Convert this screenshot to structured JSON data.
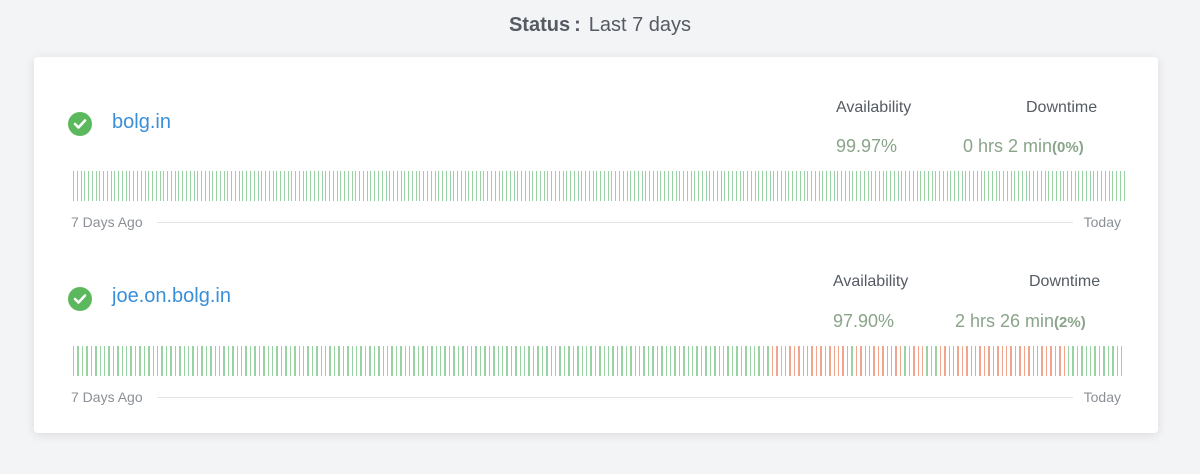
{
  "header": {
    "label": "Status",
    "colon": ":",
    "range": "Last 7 days"
  },
  "colors": {
    "up": "#9ad3a3",
    "down": "#f0a58e",
    "link": "#3a8fd9",
    "ok": "#5cb85c"
  },
  "monitors": [
    {
      "name": "bolg.in",
      "status_icon": "check-circle-icon",
      "availability_label": "Availability",
      "availability": "99.97%",
      "downtime_label": "Downtime",
      "downtime": "0 hrs 2 min",
      "downtime_pct": "(0%)",
      "axis_start": "7 Days Ago",
      "axis_end": "Today",
      "segments": "uuuuuuuuuuuuuuuuuuuuuuuuuuuuuuuuuuuuuuuuuuuuuuuuuuuuuuuuuuuuuuuuuuuuuuuuuuuuuuuuuuuuuuuuuuuuuuuuuuuuuuuuuuuuuuuuuuuuuuuuuuuuuuuuuuuuuuuuuuuuuuuuuuuuuuuuuuuuuuuuuuuuuuuuuuuudpuuuuuuuuuuuuuuuuuuuuuuuuuuuuuuuuuuuuuuuuuuuuuuuuuuuuuuuuuuuuuuuuuuuuuuuuuuuuuuuuuuuuuuuuuuuuuuuuuuuuuuuuuu"
    },
    {
      "name": "joe.on.bolg.in",
      "status_icon": "check-circle-icon",
      "availability_label": "Availability",
      "availability": "97.90%",
      "downtime_label": "Downtime",
      "downtime": "2 hrs 26 min",
      "downtime_pct": "(2%)",
      "axis_start": "7 Days Ago",
      "axis_end": "Today",
      "segments": "uuuuuuuuuuuuuuuuuuuuuuuuuuuuuuuuuuuuuuuuuuuuuuuuuuuuuuuuuuuuuuuuuuuuuuuuuuuuuuuuuuuuuuuuuuuuuuuuuuuuuuuuuuuuuuuuuuuuuuuuuuuuuuuuuuuuuuuuuuuuuuuuuuuuuuuuuuuuuudduudddddddddddddduddddddddddduuddduuuddddddddddddddddddddddddddddduuuuuuuuuuuuu"
    }
  ]
}
